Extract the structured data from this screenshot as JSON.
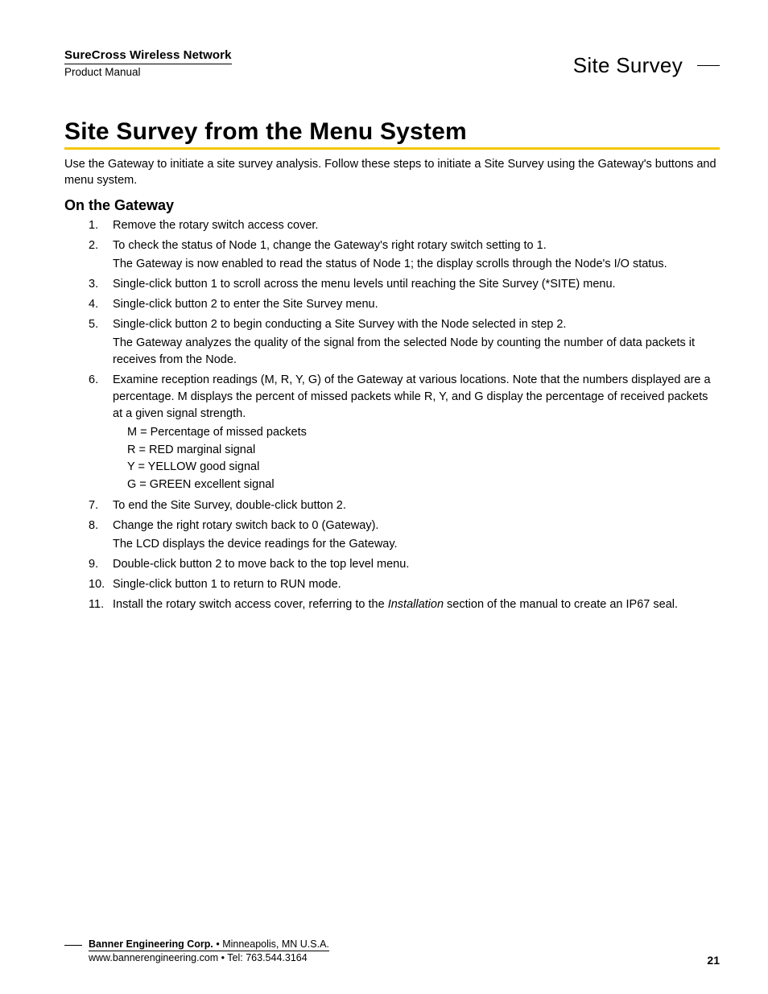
{
  "header": {
    "doc_title": "SureCross Wireless Network",
    "doc_sub": "Product Manual",
    "section": "Site Survey"
  },
  "main": {
    "title": "Site Survey from the Menu System",
    "intro": "Use the Gateway to initiate a site survey analysis. Follow these steps to initiate a Site Survey using the Gateway's buttons and menu system.",
    "subheading": "On the Gateway",
    "steps": [
      {
        "text": "Remove the rotary switch access cover."
      },
      {
        "text": "To check the status of Node 1, change the Gateway's right rotary switch setting to 1.",
        "note": "The Gateway is now enabled to read the status of Node 1; the display scrolls through the Node's I/O status."
      },
      {
        "text": "Single-click button 1 to scroll across the menu levels until reaching the Site Survey (*SITE) menu."
      },
      {
        "text": "Single-click button 2 to enter the Site Survey menu."
      },
      {
        "text": "Single-click button 2 to begin conducting a Site Survey with the Node selected in step 2.",
        "note": "The Gateway analyzes the quality of the signal from the selected Node by counting the number of data packets it receives from the Node."
      },
      {
        "text": "Examine reception readings (M, R, Y, G) of the Gateway at various locations. Note that the numbers displayed are a percentage. M displays the percent of missed packets while R, Y, and G display the percentage of received packets at a given signal strength.",
        "defs": [
          "M = Percentage of missed packets",
          "R = RED marginal signal",
          "Y = YELLOW good signal",
          "G = GREEN excellent signal"
        ]
      },
      {
        "text": "To end the Site Survey, double-click button 2."
      },
      {
        "text": "Change the right rotary switch back to 0 (Gateway).",
        "note": "The LCD displays the device readings for the Gateway."
      },
      {
        "text": "Double-click button 2 to move back to the top level menu."
      },
      {
        "text": "Single-click button 1 to return to RUN mode."
      },
      {
        "text_pre": "Install the rotary switch access cover, referring to the ",
        "text_ital": "Installation",
        "text_post": " section of the manual to create an IP67 seal."
      }
    ]
  },
  "footer": {
    "company": "Banner Engineering Corp.",
    "location": " •  Minneapolis, MN U.S.A.",
    "contact": "www.bannerengineering.com  •  Tel: 763.544.3164",
    "page": "21"
  }
}
